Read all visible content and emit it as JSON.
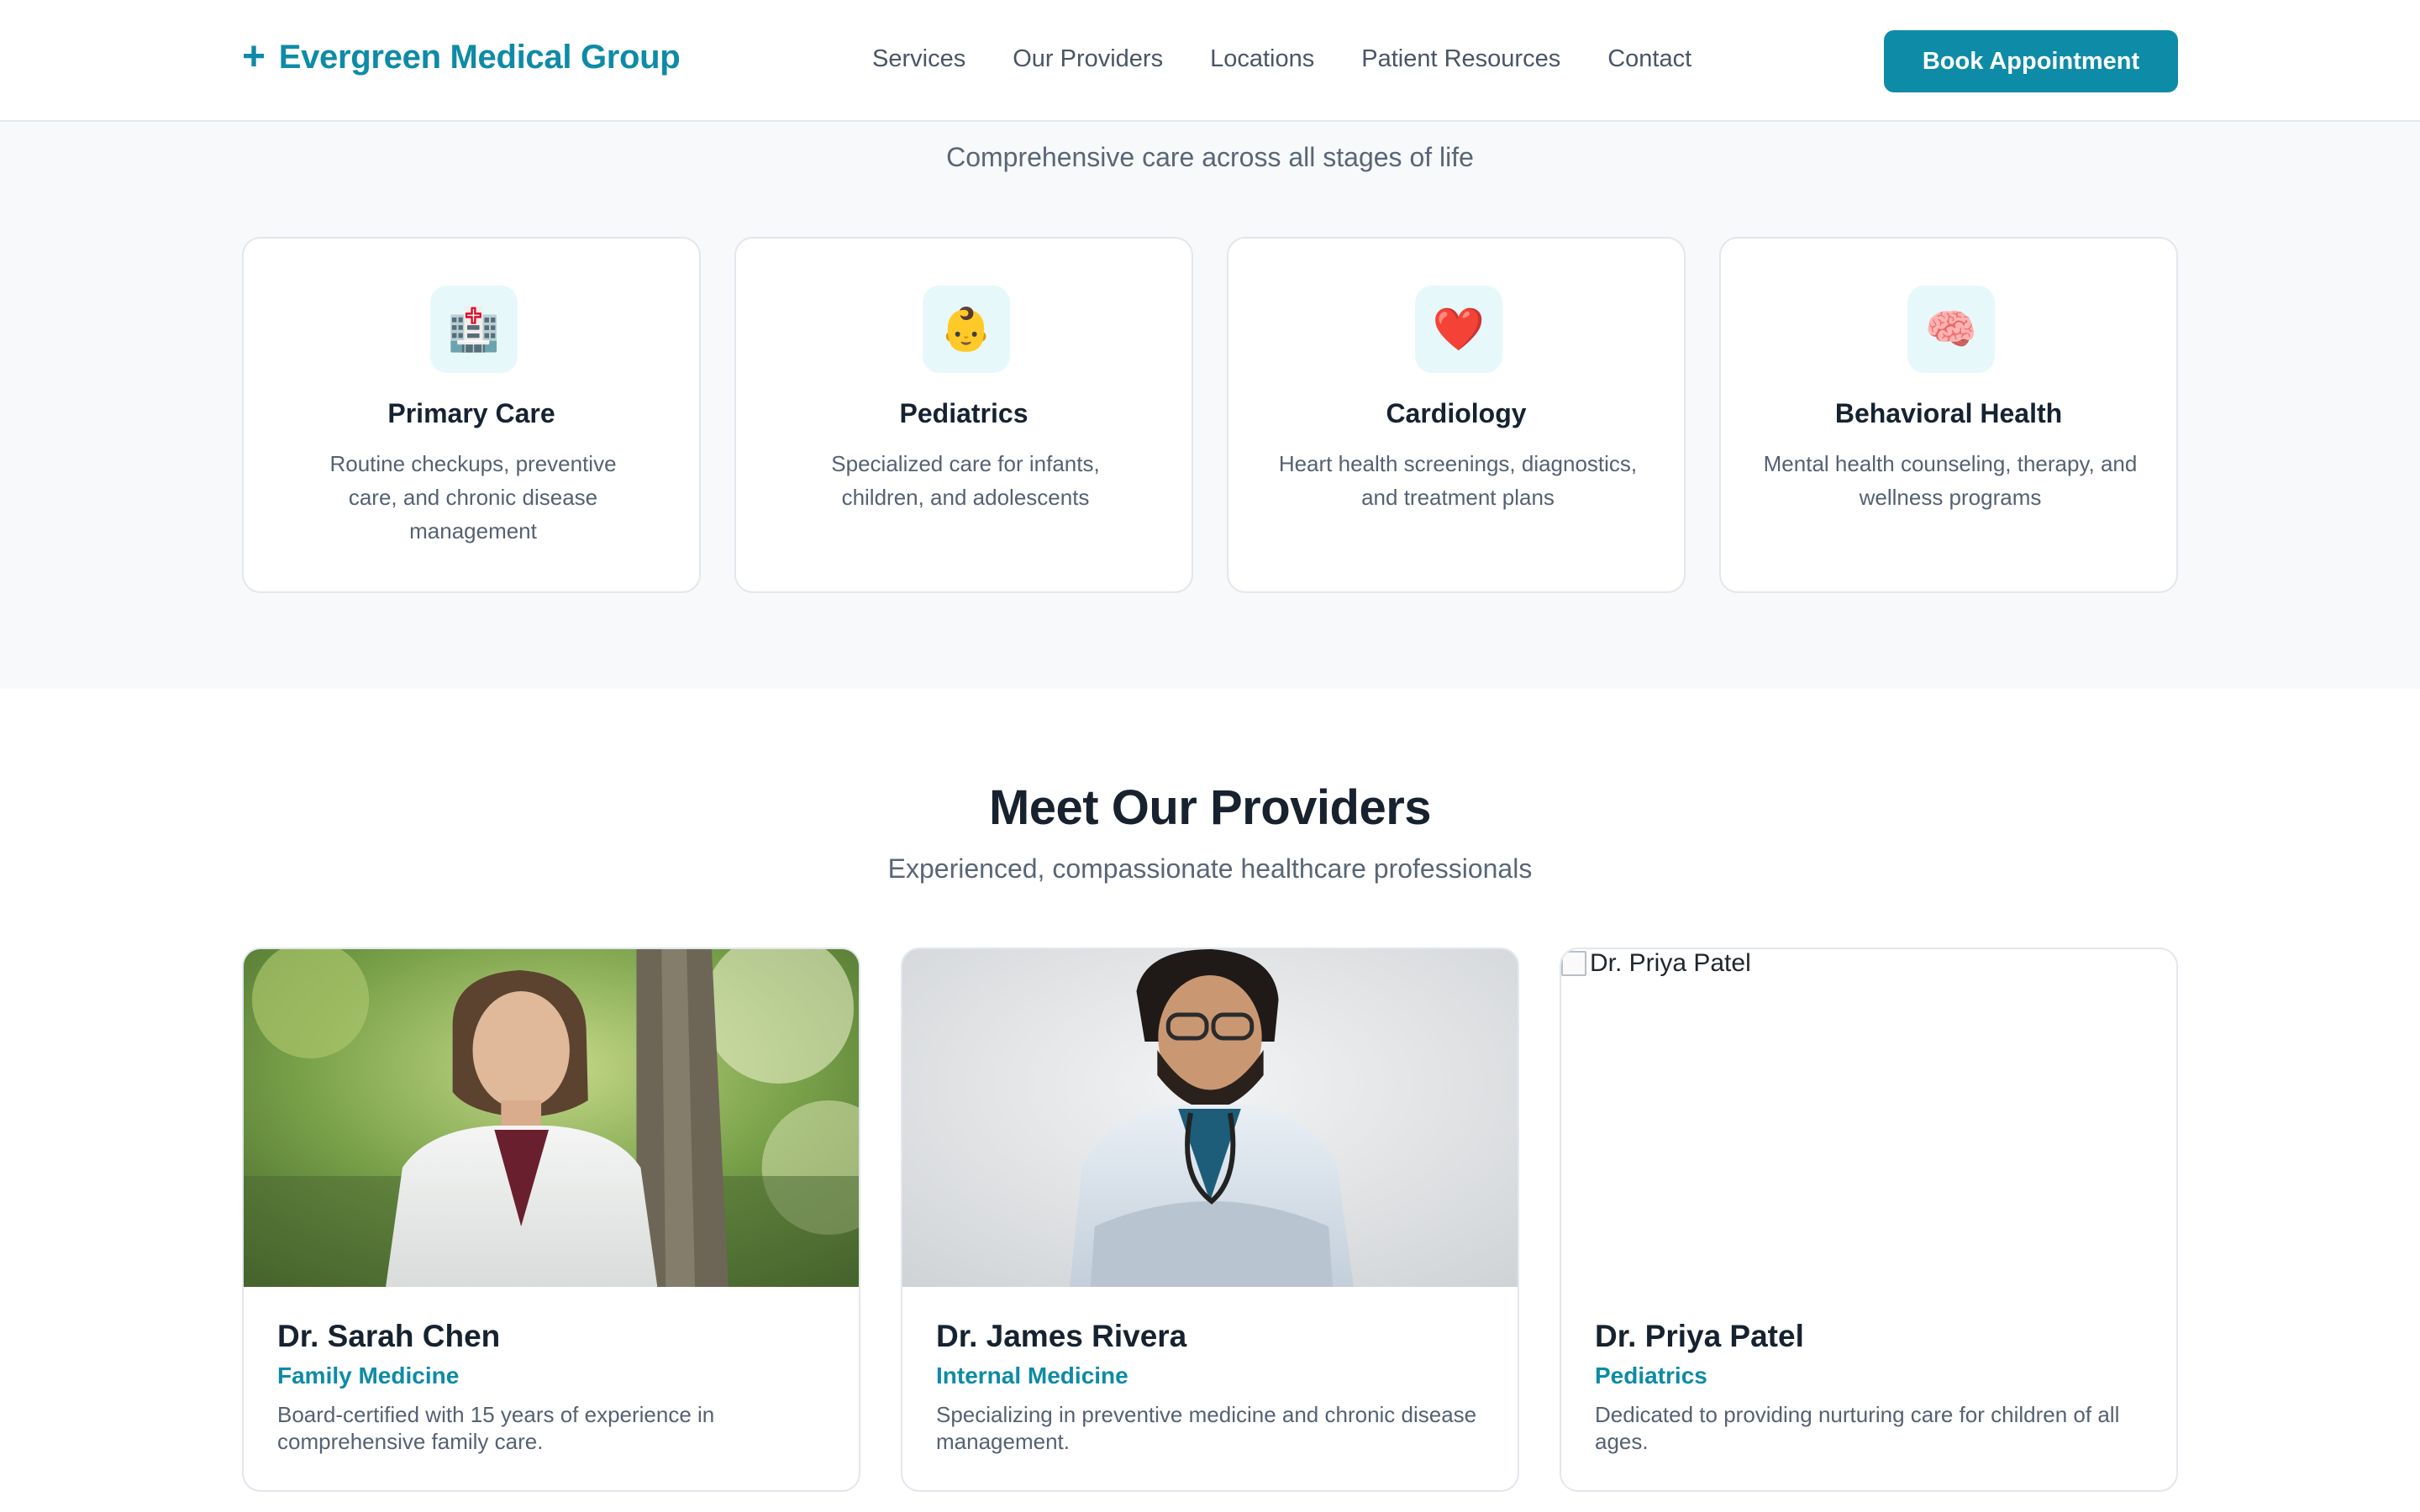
{
  "header": {
    "brand_icon": "plus-icon",
    "brand_name": "Evergreen Medical Group",
    "nav": [
      "Services",
      "Our Providers",
      "Locations",
      "Patient Resources",
      "Contact"
    ],
    "cta_label": "Book Appointment"
  },
  "services": {
    "subtitle": "Comprehensive care across all stages of life",
    "items": [
      {
        "icon": "hospital-icon",
        "glyph": "🏥",
        "title": "Primary Care",
        "description": "Routine checkups, preventive care, and chronic disease management"
      },
      {
        "icon": "baby-icon",
        "glyph": "👶",
        "title": "Pediatrics",
        "description": "Specialized care for infants, children, and adolescents"
      },
      {
        "icon": "heart-icon",
        "glyph": "❤️",
        "title": "Cardiology",
        "description": "Heart health screenings, diagnostics, and treatment plans"
      },
      {
        "icon": "brain-icon",
        "glyph": "🧠",
        "title": "Behavioral Health",
        "description": "Mental health counseling, therapy, and wellness programs"
      }
    ]
  },
  "providers": {
    "title": "Meet Our Providers",
    "subtitle": "Experienced, compassionate healthcare professionals",
    "items": [
      {
        "name": "Dr. Sarah Chen",
        "specialty": "Family Medicine",
        "bio": "Board-certified with 15 years of experience in comprehensive family care."
      },
      {
        "name": "Dr. James Rivera",
        "specialty": "Internal Medicine",
        "bio": "Specializing in preventive medicine and chronic disease management."
      },
      {
        "name": "Dr. Priya Patel",
        "specialty": "Pediatrics",
        "bio": "Dedicated to providing nurturing care for children of all ages.",
        "photo_alt": "Dr. Priya Patel"
      }
    ]
  },
  "colors": {
    "accent": "#0e8ba6",
    "text_dark": "#18222f",
    "text_muted": "#5a6677",
    "section_bg": "#f7f9fb",
    "icon_bg": "#e7f8fb"
  }
}
